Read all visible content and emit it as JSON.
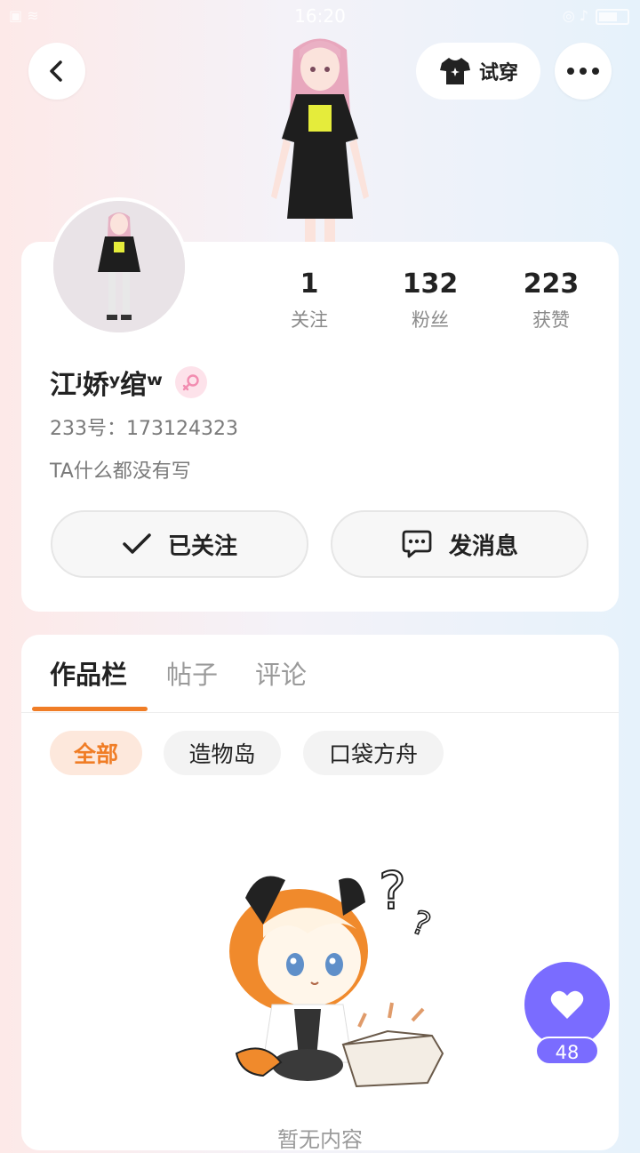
{
  "status_bar": {
    "time": "16:20"
  },
  "header": {
    "tryon_label": "试穿"
  },
  "profile": {
    "stats": [
      {
        "value": "1",
        "label": "关注"
      },
      {
        "value": "132",
        "label": "粉丝"
      },
      {
        "value": "223",
        "label": "获赞"
      }
    ],
    "username": "江ʲ娇ʸ绾ʷ",
    "uid_text": "233号：173124323",
    "bio": "TA什么都没有写",
    "follow_label": "已关注",
    "message_label": "发消息"
  },
  "tabs": [
    {
      "label": "作品栏",
      "active": true
    },
    {
      "label": "帖子",
      "active": false
    },
    {
      "label": "评论",
      "active": false
    }
  ],
  "filters": [
    {
      "label": "全部",
      "active": true
    },
    {
      "label": "造物岛",
      "active": false
    },
    {
      "label": "口袋方舟",
      "active": false
    }
  ],
  "empty_text": "暂无内容",
  "like": {
    "count": "48"
  },
  "colors": {
    "accent": "#f07d26",
    "like": "#7a6cff",
    "gender": "#f28cb0"
  }
}
